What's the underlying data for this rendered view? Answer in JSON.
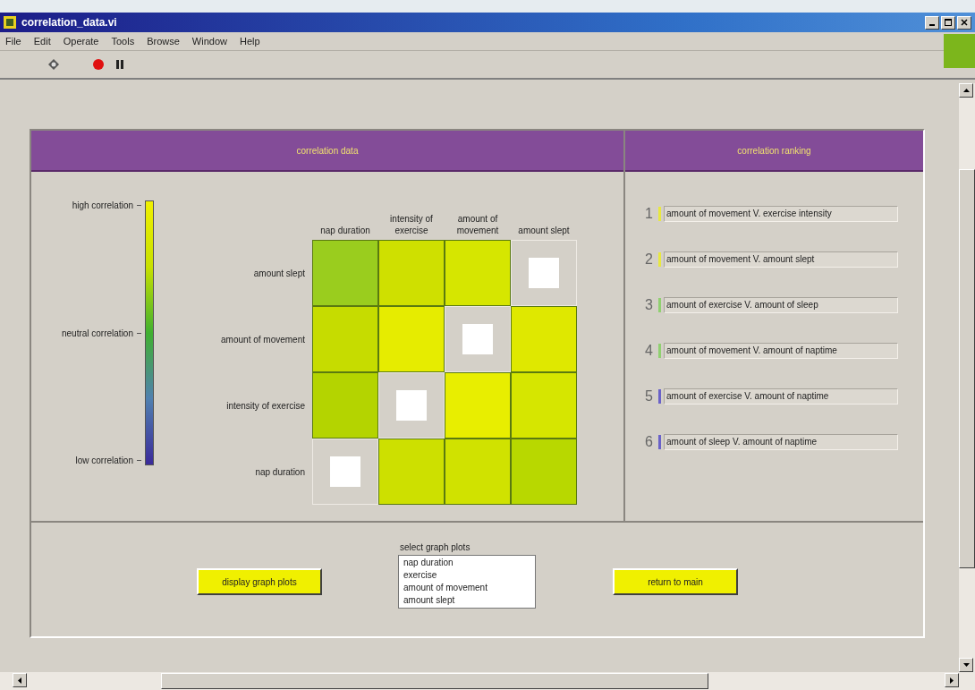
{
  "window": {
    "title": "correlation_data.vi"
  },
  "menu": [
    "File",
    "Edit",
    "Operate",
    "Tools",
    "Browse",
    "Window",
    "Help"
  ],
  "correlation_data": {
    "title": "correlation data",
    "scale": {
      "high": "high correlation",
      "neutral": "neutral correlation",
      "low": "low correlation"
    },
    "columns": [
      "nap duration",
      "intensity of exercise",
      "amount of movement",
      "amount slept"
    ],
    "rows": [
      {
        "label": "amount slept",
        "cells": [
          {
            "kind": "value",
            "color": "#9acd1e"
          },
          {
            "kind": "value",
            "color": "#cfe000"
          },
          {
            "kind": "value",
            "color": "#d6e600"
          },
          {
            "kind": "diagonal"
          }
        ]
      },
      {
        "label": "amount of movement",
        "cells": [
          {
            "kind": "value",
            "color": "#c6dc00"
          },
          {
            "kind": "value",
            "color": "#e6ec00"
          },
          {
            "kind": "diagonal"
          },
          {
            "kind": "value",
            "color": "#dfe800"
          }
        ]
      },
      {
        "label": "intensity of exercise",
        "cells": [
          {
            "kind": "value",
            "color": "#b4d400"
          },
          {
            "kind": "diagonal"
          },
          {
            "kind": "value",
            "color": "#e8ee00"
          },
          {
            "kind": "value",
            "color": "#d6e600"
          }
        ]
      },
      {
        "label": "nap duration",
        "cells": [
          {
            "kind": "diagonal"
          },
          {
            "kind": "value",
            "color": "#cde000"
          },
          {
            "kind": "value",
            "color": "#d0e200"
          },
          {
            "kind": "value",
            "color": "#b8d800"
          }
        ]
      }
    ]
  },
  "correlation_ranking": {
    "title": "correlation ranking",
    "items": [
      {
        "rank": "1",
        "text": "amount of movement V. exercise intensity",
        "color": "#e8e840"
      },
      {
        "rank": "2",
        "text": "amount of movement V. amount slept",
        "color": "#e8e840"
      },
      {
        "rank": "3",
        "text": "amount of exercise V. amount of sleep",
        "color": "#90d070"
      },
      {
        "rank": "4",
        "text": "amount of movement V. amount of naptime",
        "color": "#90d070"
      },
      {
        "rank": "5",
        "text": "amount of exercise V. amount of naptime",
        "color": "#6a62c8"
      },
      {
        "rank": "6",
        "text": "amount of sleep V. amount of naptime",
        "color": "#6a62c8"
      }
    ]
  },
  "controls": {
    "display_button": "display graph plots",
    "list_label": "select graph plots",
    "list_items": [
      "nap duration",
      "exercise",
      "amount of movement",
      "amount slept"
    ],
    "return_button": "return to main"
  }
}
